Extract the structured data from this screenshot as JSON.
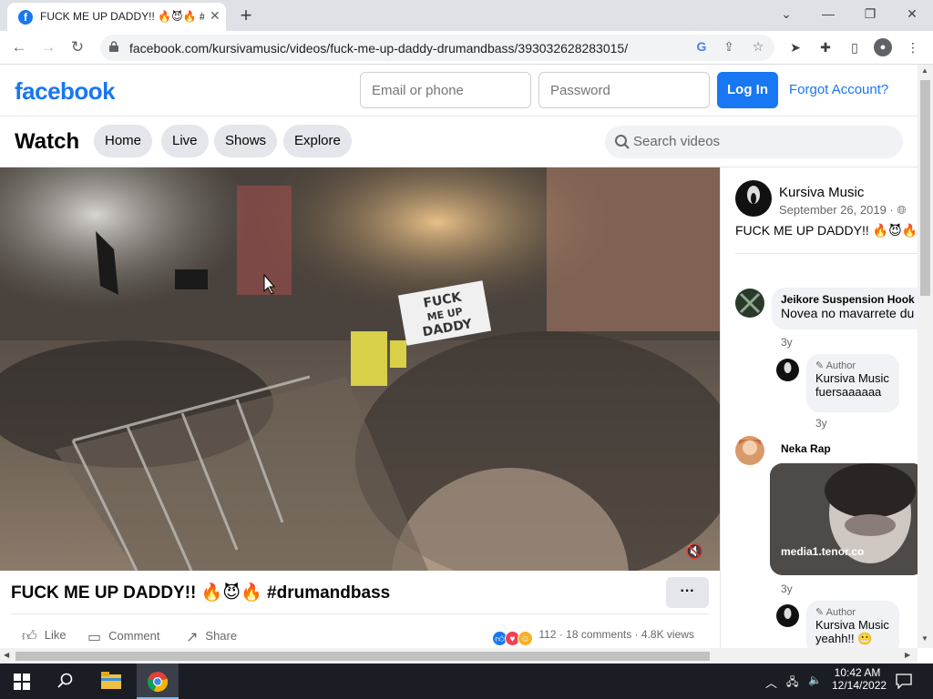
{
  "browser": {
    "tab_title": "FUCK ME UP DADDY!! 🔥😈🔥 #",
    "url": "facebook.com/kursivamusic/videos/fuck-me-up-daddy-drumandbass/393032628283015/"
  },
  "header": {
    "logo": "facebook",
    "email_placeholder": "Email or phone",
    "password_placeholder": "Password",
    "login_label": "Log In",
    "forgot_label": "Forgot Account?"
  },
  "watch": {
    "title": "Watch",
    "nav": [
      "Home",
      "Live",
      "Shows",
      "Explore"
    ],
    "search_placeholder": "Search videos"
  },
  "video": {
    "sign_text": "FUCK ME UP DADDY",
    "title": "FUCK ME UP DADDY!! 🔥😈🔥 #drumandbass",
    "actions": [
      "Like",
      "Comment",
      "Share"
    ],
    "reaction_count": "112",
    "comments": "18 comments",
    "views": "4.8K views"
  },
  "post": {
    "page_name": "Kursiva Music",
    "date": "September 26, 2019 · ",
    "caption": "FUCK ME UP DADDY!! 🔥😈🔥"
  },
  "comments": [
    {
      "name": "Jeikore Suspension Hook",
      "text": "Novea no mavarrete du",
      "time": "3y"
    },
    {
      "badge": "Author",
      "name": "Kursiva Music",
      "text": "fuersaaaaaa",
      "time": "3y"
    },
    {
      "name": "Neka Rap",
      "gif_source": "media1.tenor.co",
      "time": "3y"
    },
    {
      "badge": "Author",
      "name": "Kursiva Music",
      "text": "yeahh!! 😬"
    }
  ],
  "taskbar": {
    "time": "10:42 AM",
    "date": "12/14/2022"
  },
  "colors": {
    "facebook_blue": "#1877f2",
    "pill_gray": "#e4e6eb",
    "taskbar": "#1a1d24"
  }
}
